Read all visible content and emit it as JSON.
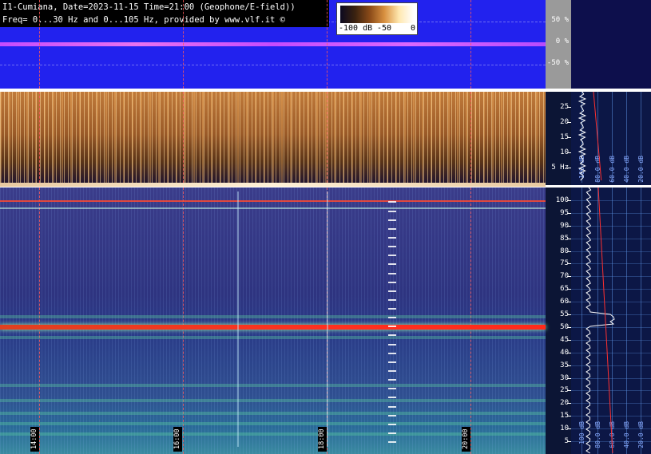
{
  "header": {
    "line1": "I1-Cumiana, Date=2023-11-15 Time=21:00 (Geophone/E-field))",
    "line2": "Freq= 0...30 Hz and 0...105 Hz, provided by www.vlf.it ©"
  },
  "colorbar": {
    "min_label": "-100 dB",
    "mid_label": "-50",
    "max_label": "0"
  },
  "amplitude_scale": [
    "50 %",
    "0 %",
    "-50 %"
  ],
  "mid_freq_ticks": [
    "25",
    "20",
    "15",
    "10",
    "5 Hz"
  ],
  "low_freq_ticks": [
    "100",
    "95",
    "90",
    "85",
    "80",
    "75",
    "70",
    "65",
    "60",
    "55",
    "50",
    "45",
    "40",
    "35",
    "30",
    "25",
    "20",
    "15",
    "10",
    "5"
  ],
  "time_labels": [
    "14:00",
    "16:00",
    "18:00",
    "20:00"
  ],
  "profile_db_labels": [
    "100 dB",
    "80.0 dB",
    "60.0 dB",
    "40.0 dB",
    "20.0 dB"
  ],
  "colors": {
    "amp_background": "#2222ee",
    "amp_trace": "#e060ff",
    "schumann_line": "#ff2a1a",
    "grid_dashed": "#ff5a5a",
    "profile_background": "#0c1746"
  }
}
